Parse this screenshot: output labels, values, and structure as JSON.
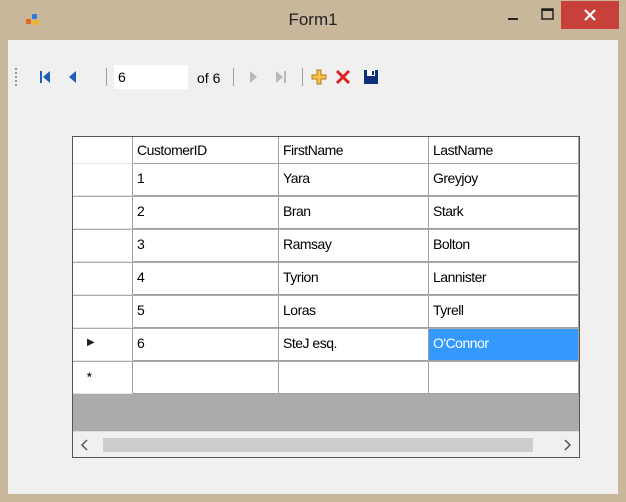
{
  "window": {
    "title": "Form1"
  },
  "navigator": {
    "position": "6",
    "count_label": "of 6",
    "buttons": [
      "move-first",
      "move-previous",
      "move-next",
      "move-last",
      "add-new",
      "delete",
      "save"
    ]
  },
  "grid": {
    "columns": [
      "CustomerID",
      "FirstName",
      "LastName"
    ],
    "rows": [
      {
        "id": "1",
        "first": "Yara",
        "last": "Greyjoy"
      },
      {
        "id": "2",
        "first": "Bran",
        "last": "Stark"
      },
      {
        "id": "3",
        "first": "Ramsay",
        "last": "Bolton"
      },
      {
        "id": "4",
        "first": "Tyrion",
        "last": "Lannister"
      },
      {
        "id": "5",
        "first": "Loras",
        "last": "Tyrell"
      },
      {
        "id": "6",
        "first": "SteJ esq.",
        "last": "O'Connor"
      }
    ],
    "current_row_marker": "▶",
    "new_row_marker": "*",
    "selected": {
      "row": 5,
      "column": "last"
    }
  },
  "colors": {
    "titlebar": "#c8b79b",
    "close": "#c7403a",
    "selection": "#3399ff"
  }
}
